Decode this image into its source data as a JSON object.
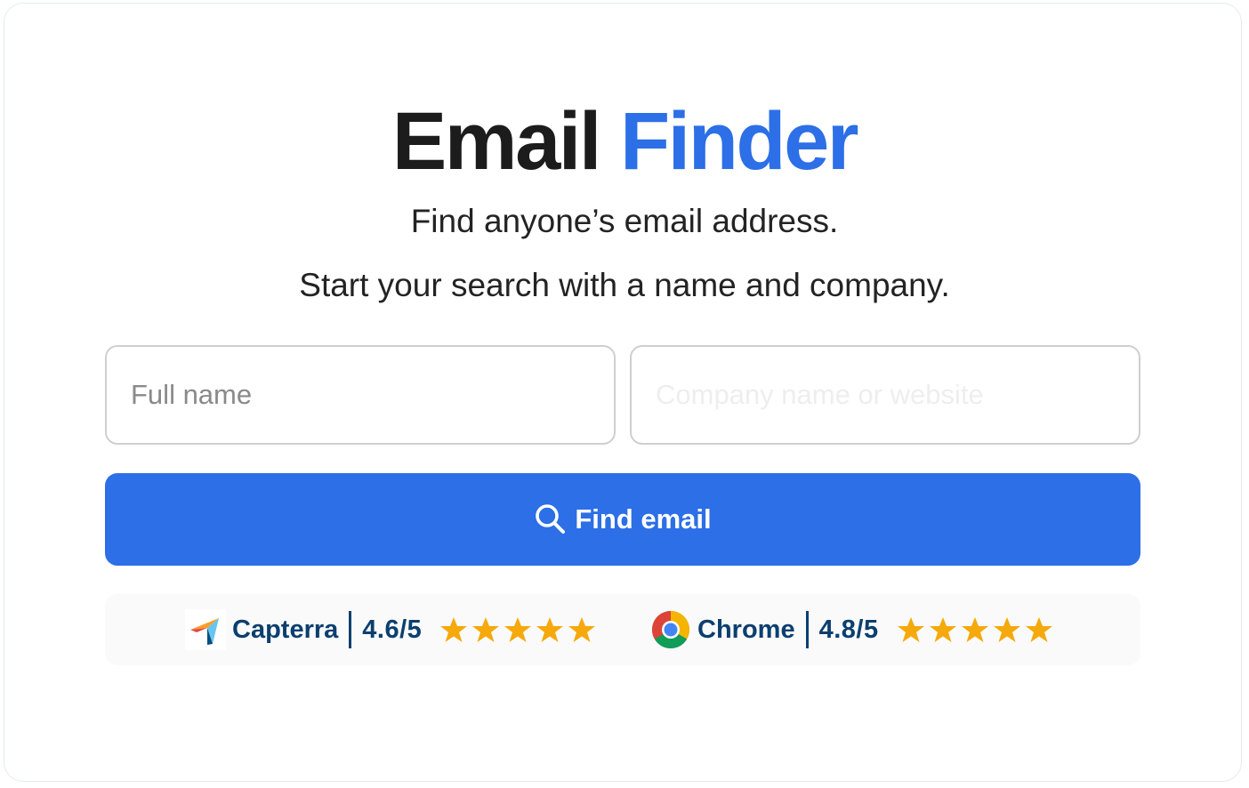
{
  "header": {
    "title_main": "Email",
    "title_accent": "Finder",
    "subtitle_line1": "Find anyone’s email address.",
    "subtitle_line2": "Start your search with a name and company."
  },
  "form": {
    "name_placeholder": "Full name",
    "company_placeholder": "Company name or website",
    "button_label": "Find email",
    "button_icon": "search-icon"
  },
  "ratings": [
    {
      "name": "Capterra",
      "score": "4.6/5",
      "logo": "capterra-logo",
      "stars": 5
    },
    {
      "name": "Chrome",
      "score": "4.8/5",
      "logo": "chrome-logo",
      "stars": 5
    }
  ],
  "colors": {
    "accent": "#2c6fe7",
    "rating_text": "#0b3f6f",
    "star": "#f5a90b"
  }
}
